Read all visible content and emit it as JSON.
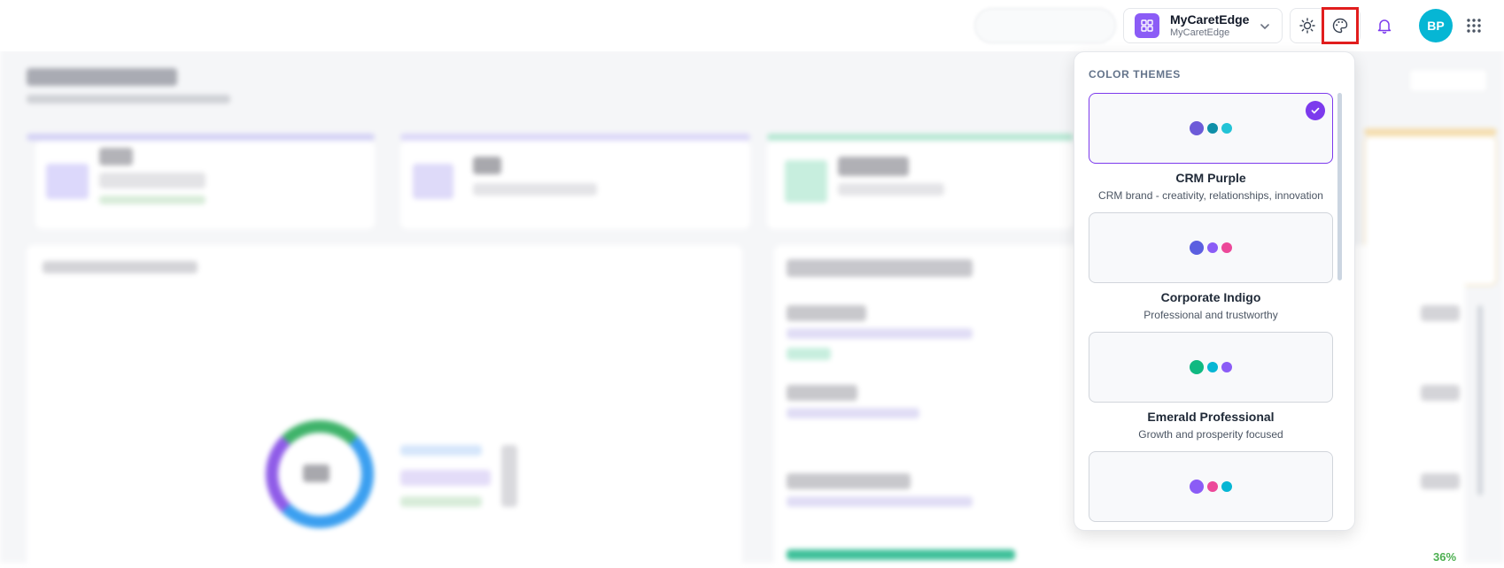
{
  "header": {
    "workspace_name": "MyCaretEdge",
    "workspace_sub": "MyCaretEdge",
    "avatar_initials": "BP",
    "icons": [
      "sun-icon",
      "palette-icon",
      "bell-icon",
      "grid-icon",
      "chevron-down-icon"
    ]
  },
  "dashboard": {
    "progress_label": "36%"
  },
  "color_themes": {
    "title": "COLOR THEMES",
    "items": [
      {
        "name": "CRM Purple",
        "description": "CRM brand - creativity, relationships, innovation",
        "selected": true,
        "colors": [
          "#6d5bd8",
          "#0e8fa8",
          "#22c3d6"
        ]
      },
      {
        "name": "Corporate Indigo",
        "description": "Professional and trustworthy",
        "selected": false,
        "colors": [
          "#5b5fe0",
          "#8b5cf6",
          "#ec4899"
        ]
      },
      {
        "name": "Emerald Professional",
        "description": "Growth and prosperity focused",
        "selected": false,
        "colors": [
          "#10b981",
          "#06b6d4",
          "#8b5cf6"
        ]
      },
      {
        "name": "",
        "description": "",
        "selected": false,
        "colors": [
          "#8b5cf6",
          "#ec4899",
          "#06b6d4"
        ]
      }
    ]
  },
  "colors": {
    "accent": "#7c3aed",
    "highlight": "#e11d1d",
    "avatar": "#06b6d4"
  }
}
